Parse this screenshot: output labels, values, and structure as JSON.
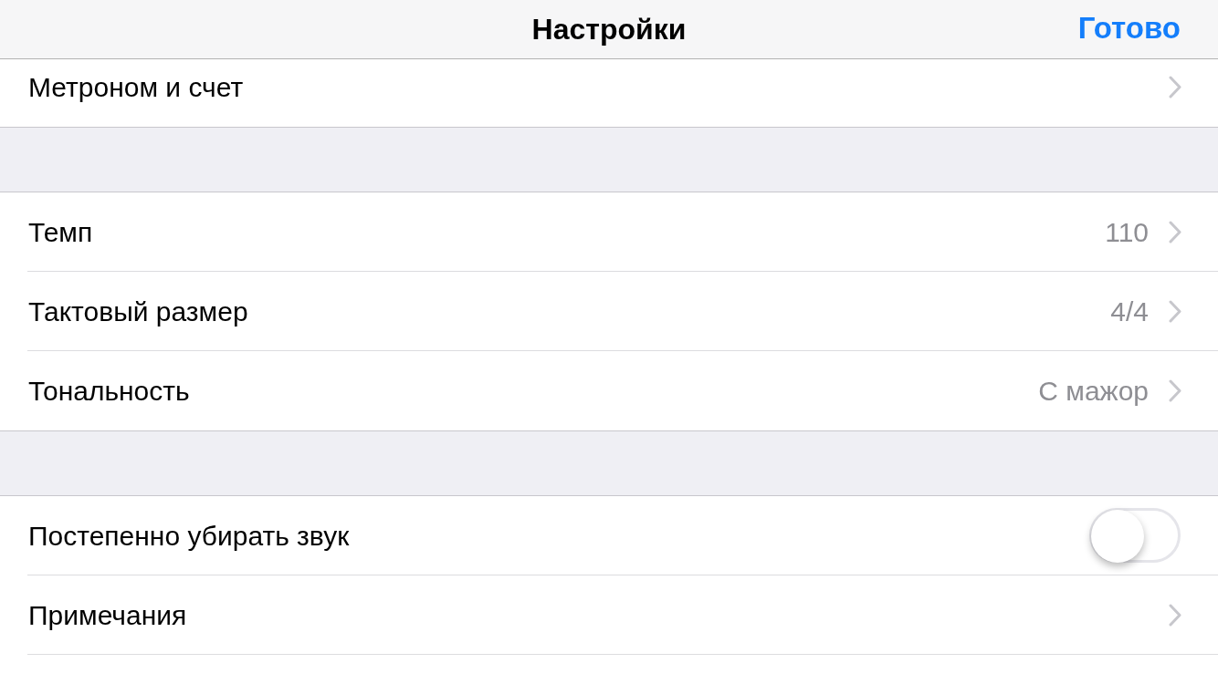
{
  "nav_bar": {
    "title": "Настройки",
    "done_button": "Готово"
  },
  "sections": [
    {
      "rows": [
        {
          "kind": "disclosure",
          "label": "Метроном и счет"
        }
      ]
    },
    {
      "rows": [
        {
          "kind": "disclosure",
          "label": "Темп",
          "value": "110"
        },
        {
          "kind": "disclosure",
          "label": "Тактовый размер",
          "value": "4/4"
        },
        {
          "kind": "disclosure",
          "label": "Тональность",
          "value": "C мажор"
        }
      ]
    },
    {
      "rows": [
        {
          "kind": "toggle",
          "label": "Постепенно убирать звук",
          "on": false
        },
        {
          "kind": "disclosure",
          "label": "Примечания"
        }
      ]
    }
  ]
}
